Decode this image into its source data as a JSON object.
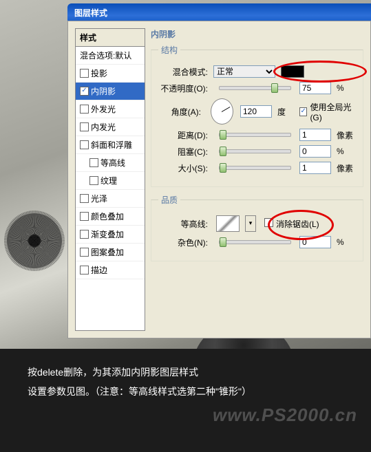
{
  "window": {
    "title": "图层样式"
  },
  "styles": {
    "header": "样式",
    "blend_default": "混合选项:默认",
    "items": [
      {
        "label": "投影",
        "checked": false
      },
      {
        "label": "内阴影",
        "checked": true,
        "selected": true
      },
      {
        "label": "外发光",
        "checked": false
      },
      {
        "label": "内发光",
        "checked": false
      },
      {
        "label": "斜面和浮雕",
        "checked": false
      },
      {
        "label": "等高线",
        "checked": false,
        "indent": true
      },
      {
        "label": "纹理",
        "checked": false,
        "indent": true
      },
      {
        "label": "光泽",
        "checked": false
      },
      {
        "label": "颜色叠加",
        "checked": false
      },
      {
        "label": "渐变叠加",
        "checked": false
      },
      {
        "label": "图案叠加",
        "checked": false
      },
      {
        "label": "描边",
        "checked": false
      }
    ]
  },
  "panel": {
    "title": "内阴影",
    "structure_title": "结构",
    "quality_title": "品质",
    "labels": {
      "blend_mode": "混合模式:",
      "opacity": "不透明度(O):",
      "angle": "角度(A):",
      "degree": "度",
      "global_light": "使用全局光(G)",
      "distance": "距离(D):",
      "choke": "阻塞(C):",
      "size": "大小(S):",
      "contour": "等高线:",
      "anti_alias": "消除锯齿(L)",
      "noise": "杂色(N):"
    },
    "values": {
      "blend_mode": "正常",
      "opacity": "75",
      "angle": "120",
      "distance": "1",
      "choke": "0",
      "size": "1",
      "noise": "0",
      "global_light_checked": true,
      "anti_alias_checked": false
    },
    "units": {
      "px": "像素",
      "pct": "%"
    }
  },
  "caption": {
    "line1": "按delete删除，为其添加内阴影图层样式",
    "line2": "设置参数见图。（注意：等高线样式选第二种\"锥形\"）"
  },
  "watermark": "www.PS2000.cn"
}
